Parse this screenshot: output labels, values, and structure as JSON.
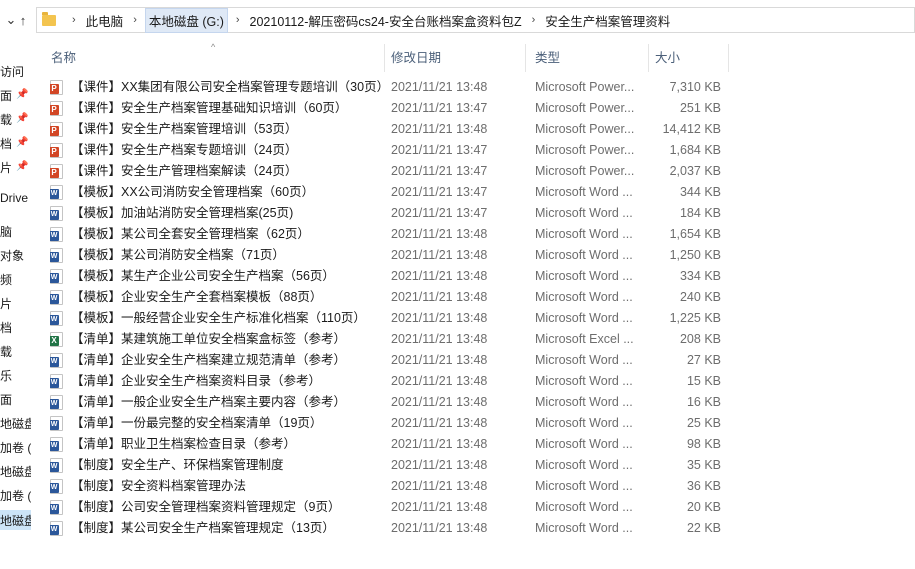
{
  "breadcrumb": [
    "此电脑",
    "本地磁盘 (G:)",
    "20210112-解压密码cs24-安全台账档案盒资料包Z",
    "安全生产档案管理资料"
  ],
  "left_pane": [
    "访问",
    "面",
    "载",
    "档",
    "片",
    "Drive",
    "脑",
    "对象",
    "频",
    "片",
    "档",
    "载",
    "乐",
    "面",
    "地磁盘",
    "加卷 (",
    "地磁盘",
    "加卷 (",
    "地磁盘"
  ],
  "columns": {
    "name": "名称",
    "date": "修改日期",
    "type": "类型",
    "size": "大小"
  },
  "files": [
    {
      "icon": "ppt",
      "name": "【课件】XX集团有限公司安全档案管理专题培训（30页）",
      "date": "2021/11/21 13:48",
      "type": "Microsoft Power...",
      "size": "7,310 KB"
    },
    {
      "icon": "ppt",
      "name": "【课件】安全生产档案管理基础知识培训（60页）",
      "date": "2021/11/21 13:47",
      "type": "Microsoft Power...",
      "size": "251 KB"
    },
    {
      "icon": "ppt",
      "name": "【课件】安全生产档案管理培训（53页）",
      "date": "2021/11/21 13:48",
      "type": "Microsoft Power...",
      "size": "14,412 KB"
    },
    {
      "icon": "ppt",
      "name": "【课件】安全生产档案专题培训（24页）",
      "date": "2021/11/21 13:47",
      "type": "Microsoft Power...",
      "size": "1,684 KB"
    },
    {
      "icon": "ppt",
      "name": "【课件】安全生产管理档案解读（24页）",
      "date": "2021/11/21 13:47",
      "type": "Microsoft Power...",
      "size": "2,037 KB"
    },
    {
      "icon": "word",
      "name": "【模板】XX公司消防安全管理档案（60页）",
      "date": "2021/11/21 13:47",
      "type": "Microsoft Word ...",
      "size": "344 KB"
    },
    {
      "icon": "word",
      "name": "【模板】加油站消防安全管理档案(25页)",
      "date": "2021/11/21 13:47",
      "type": "Microsoft Word ...",
      "size": "184 KB"
    },
    {
      "icon": "word",
      "name": "【模板】某公司全套安全管理档案（62页）",
      "date": "2021/11/21 13:48",
      "type": "Microsoft Word ...",
      "size": "1,654 KB"
    },
    {
      "icon": "word",
      "name": "【模板】某公司消防安全档案（71页）",
      "date": "2021/11/21 13:48",
      "type": "Microsoft Word ...",
      "size": "1,250 KB"
    },
    {
      "icon": "word",
      "name": "【模板】某生产企业公司安全生产档案（56页）",
      "date": "2021/11/21 13:48",
      "type": "Microsoft Word ...",
      "size": "334 KB"
    },
    {
      "icon": "word",
      "name": "【模板】企业安全生产全套档案模板（88页）",
      "date": "2021/11/21 13:48",
      "type": "Microsoft Word ...",
      "size": "240 KB"
    },
    {
      "icon": "word",
      "name": "【模板】一般经营企业安全生产标准化档案（110页）",
      "date": "2021/11/21 13:48",
      "type": "Microsoft Word ...",
      "size": "1,225 KB"
    },
    {
      "icon": "excel",
      "name": "【清单】某建筑施工单位安全档案盒标签（参考）",
      "date": "2021/11/21 13:48",
      "type": "Microsoft Excel ...",
      "size": "208 KB"
    },
    {
      "icon": "word",
      "name": "【清单】企业安全生产档案建立规范清单（参考）",
      "date": "2021/11/21 13:48",
      "type": "Microsoft Word ...",
      "size": "27 KB"
    },
    {
      "icon": "word",
      "name": "【清单】企业安全生产档案资料目录（参考）",
      "date": "2021/11/21 13:48",
      "type": "Microsoft Word ...",
      "size": "15 KB"
    },
    {
      "icon": "word",
      "name": "【清单】一般企业安全生产档案主要内容（参考）",
      "date": "2021/11/21 13:48",
      "type": "Microsoft Word ...",
      "size": "16 KB"
    },
    {
      "icon": "word",
      "name": "【清单】一份最完整的安全档案清单（19页）",
      "date": "2021/11/21 13:48",
      "type": "Microsoft Word ...",
      "size": "25 KB"
    },
    {
      "icon": "word",
      "name": "【清单】职业卫生档案检查目录（参考）",
      "date": "2021/11/21 13:48",
      "type": "Microsoft Word ...",
      "size": "98 KB"
    },
    {
      "icon": "word",
      "name": "【制度】安全生产、环保档案管理制度",
      "date": "2021/11/21 13:48",
      "type": "Microsoft Word ...",
      "size": "35 KB"
    },
    {
      "icon": "word",
      "name": "【制度】安全资料档案管理办法",
      "date": "2021/11/21 13:48",
      "type": "Microsoft Word ...",
      "size": "36 KB"
    },
    {
      "icon": "word",
      "name": "【制度】公司安全管理档案资料管理规定（9页）",
      "date": "2021/11/21 13:48",
      "type": "Microsoft Word ...",
      "size": "20 KB"
    },
    {
      "icon": "word",
      "name": "【制度】某公司安全生产档案管理规定（13页）",
      "date": "2021/11/21 13:48",
      "type": "Microsoft Word ...",
      "size": "22 KB"
    }
  ]
}
